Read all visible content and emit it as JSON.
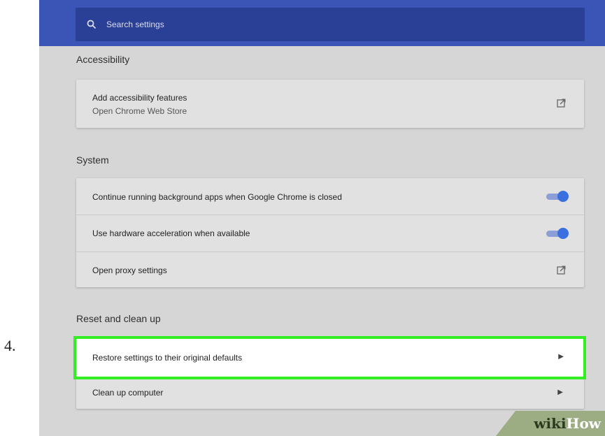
{
  "step_number": "4.",
  "search": {
    "placeholder": "Search settings"
  },
  "sections": {
    "accessibility": {
      "title": "Accessibility",
      "item": {
        "label": "Add accessibility features",
        "sublabel": "Open Chrome Web Store"
      }
    },
    "system": {
      "title": "System",
      "items": [
        {
          "label": "Continue running background apps when Google Chrome is closed",
          "control": "toggle",
          "on": true
        },
        {
          "label": "Use hardware acceleration when available",
          "control": "toggle",
          "on": true
        },
        {
          "label": "Open proxy settings",
          "control": "external-link-icon"
        }
      ]
    },
    "reset": {
      "title": "Reset and clean up",
      "items": [
        {
          "label": "Restore settings to their original defaults",
          "control": "chevron-right-icon",
          "highlighted": true
        },
        {
          "label": "Clean up computer",
          "control": "chevron-right-icon"
        }
      ]
    }
  },
  "watermark": {
    "wiki": "wiki",
    "how": "How"
  },
  "colors": {
    "header": "#3a55b5",
    "search_bar": "#2a3f96",
    "toggle_on": "#3a6fe0",
    "highlight_border": "#33ee22"
  }
}
